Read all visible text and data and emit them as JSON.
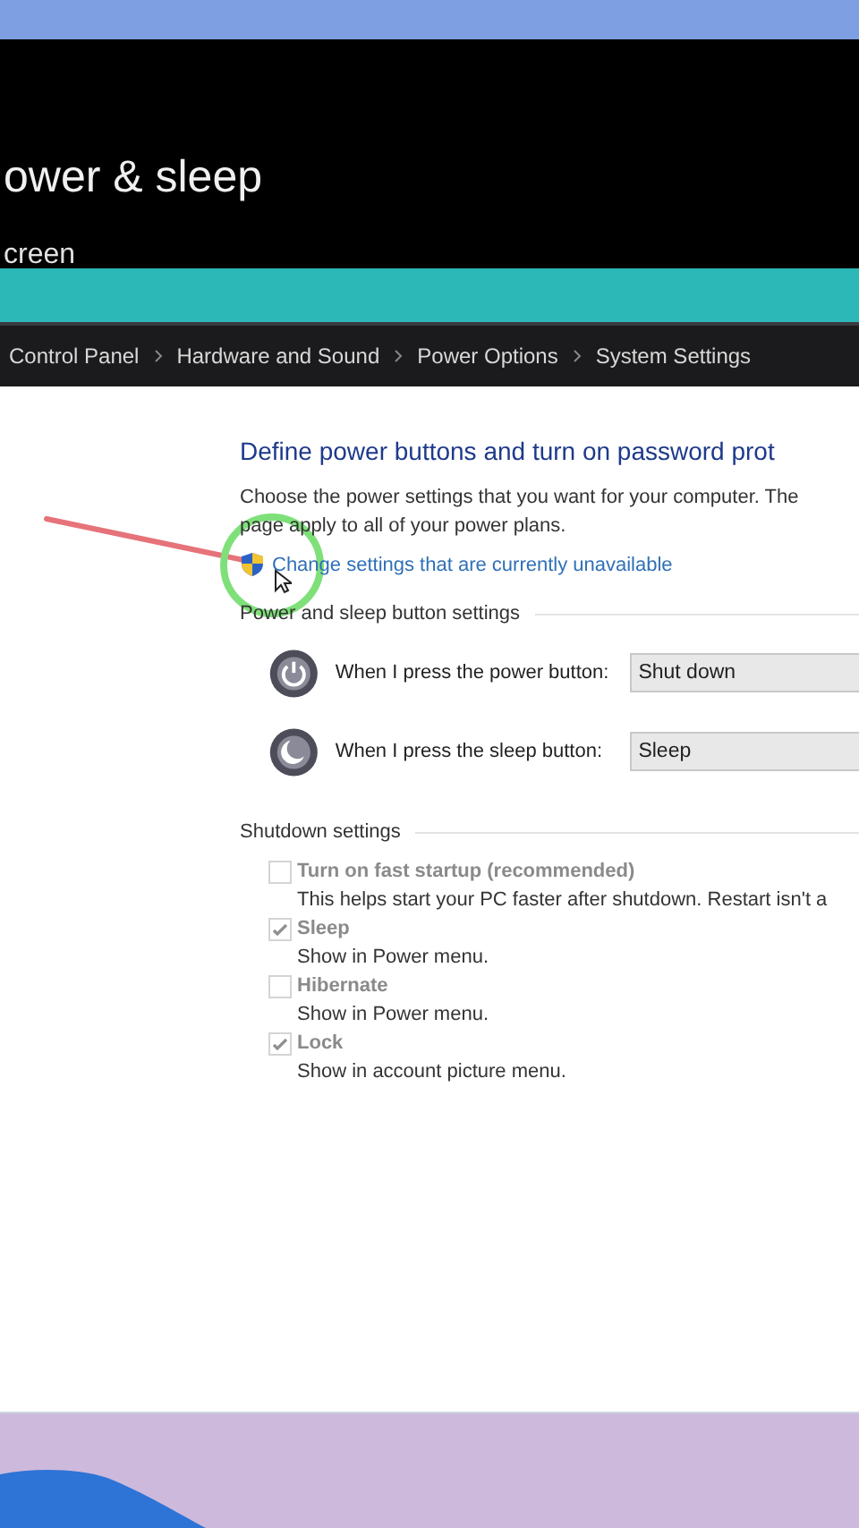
{
  "settings_window": {
    "title": "ower & sleep",
    "subheading": "creen"
  },
  "breadcrumb": [
    "Control Panel",
    "Hardware and Sound",
    "Power Options",
    "System Settings"
  ],
  "page": {
    "title": "Define power buttons and turn on password prot",
    "description_lines": [
      "Choose the power settings that you want for your computer. The",
      "page apply to all of your power plans."
    ],
    "link": "Change settings that are currently unavailable"
  },
  "power_section": {
    "heading": "Power and sleep button settings",
    "rows": [
      {
        "kind": "power",
        "label": "When I press the power button:",
        "value": "Shut down"
      },
      {
        "kind": "sleep",
        "label": "When I press the sleep button:",
        "value": "Sleep"
      }
    ]
  },
  "shutdown_section": {
    "heading": "Shutdown settings",
    "options": [
      {
        "label": "Turn on fast startup (recommended)",
        "description": "This helps start your PC faster after shutdown. Restart isn't a",
        "checked": false,
        "disabled": true
      },
      {
        "label": "Sleep",
        "description": "Show in Power menu.",
        "checked": true,
        "disabled": true
      },
      {
        "label": "Hibernate",
        "description": "Show in Power menu.",
        "checked": false,
        "disabled": true
      },
      {
        "label": "Lock",
        "description": "Show in account picture menu.",
        "checked": true,
        "disabled": true
      }
    ]
  }
}
